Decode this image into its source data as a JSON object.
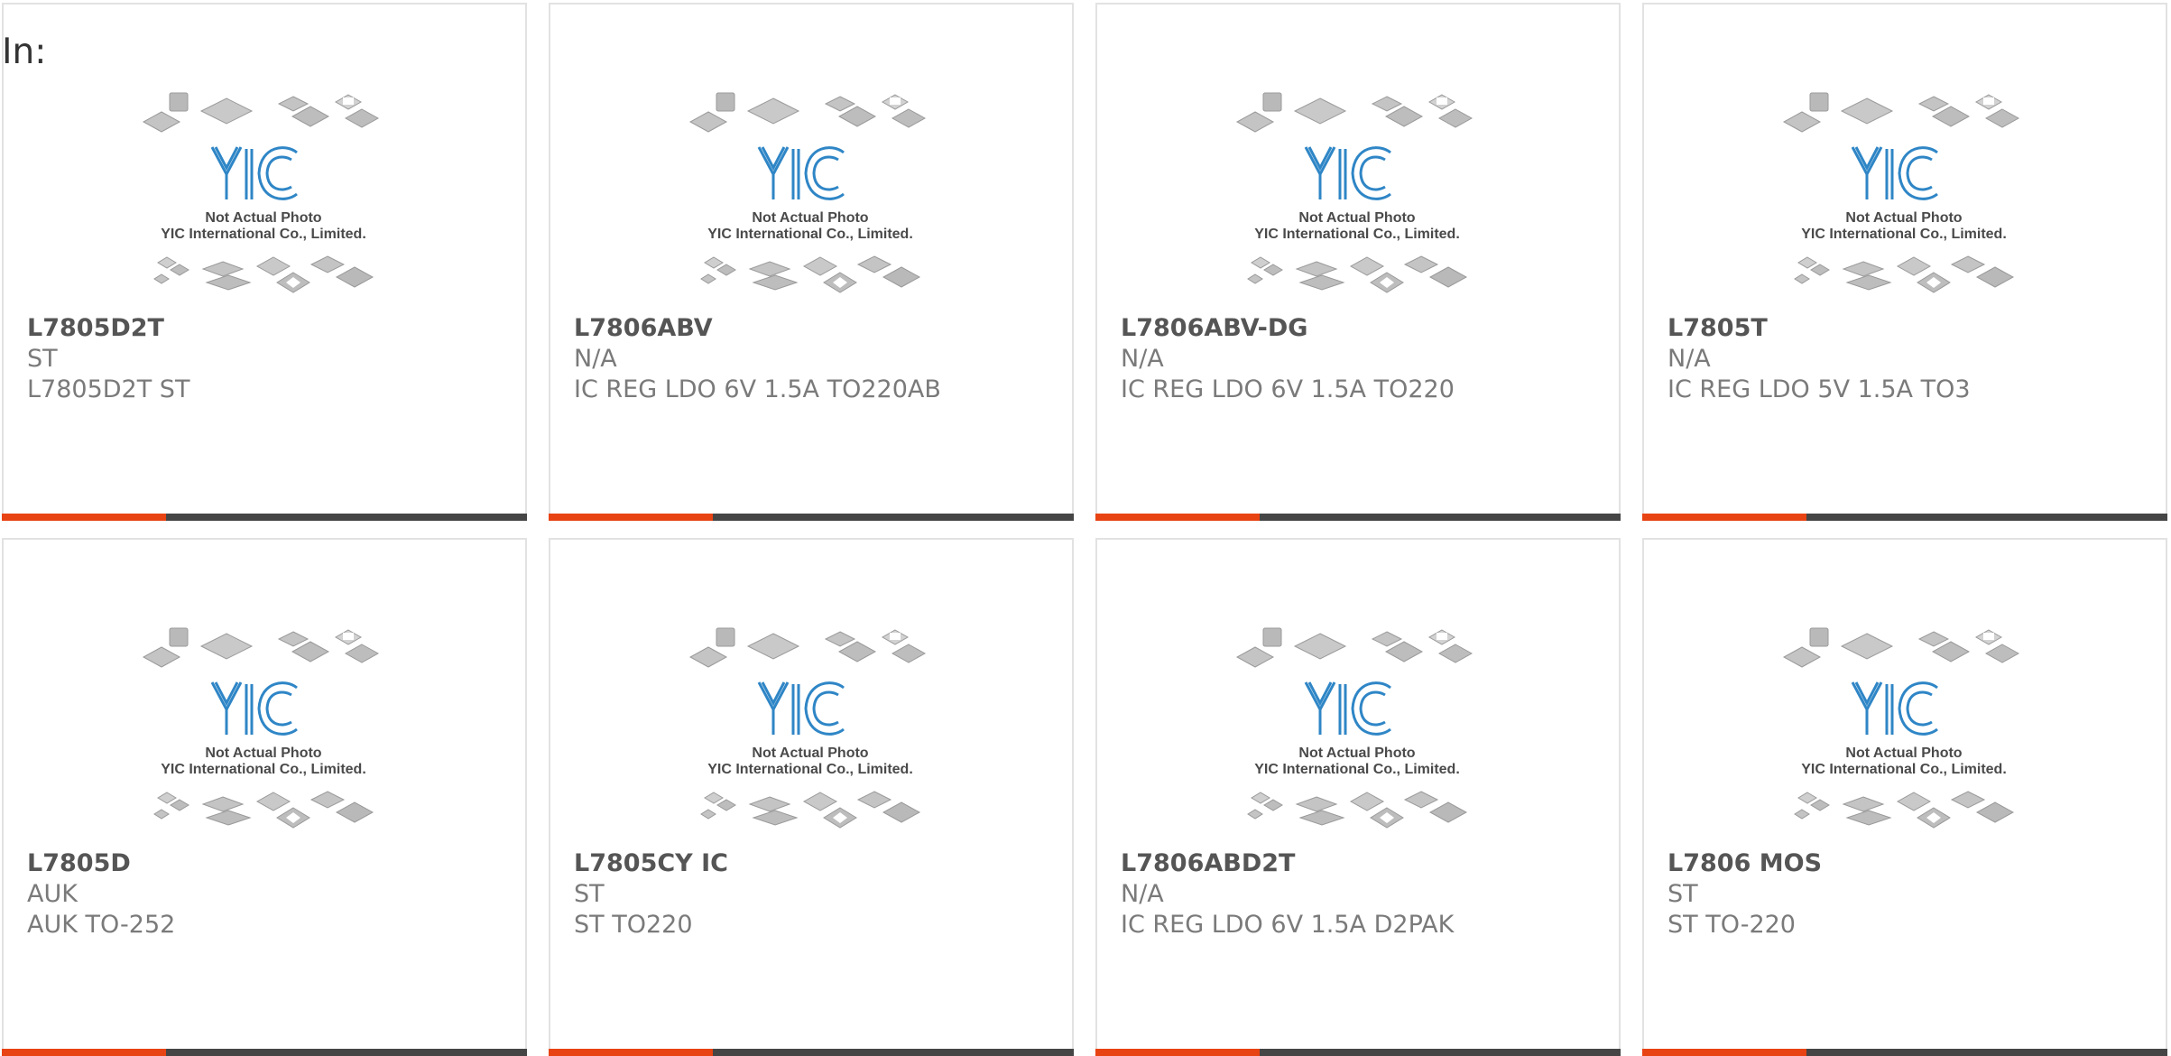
{
  "page": {
    "label": "In:"
  },
  "colors": {
    "accent": "#e84313",
    "bar": "#454545",
    "logo": "#2f86c6",
    "chip": "#b9b9b9"
  },
  "thumbnail": {
    "line1": "Not Actual Photo",
    "line2": "YIC International Co., Limited."
  },
  "products": [
    {
      "part": "L7805D2T",
      "manufacturer": "ST",
      "description": "L7805D2T ST"
    },
    {
      "part": "L7806ABV",
      "manufacturer": "N/A",
      "description": "IC REG LDO 6V 1.5A TO220AB"
    },
    {
      "part": "L7806ABV-DG",
      "manufacturer": "N/A",
      "description": "IC REG LDO 6V 1.5A TO220"
    },
    {
      "part": "L7805T",
      "manufacturer": "N/A",
      "description": "IC REG LDO 5V 1.5A TO3"
    },
    {
      "part": "L7805D",
      "manufacturer": "AUK",
      "description": "AUK TO-252"
    },
    {
      "part": "L7805CY IC",
      "manufacturer": "ST",
      "description": "ST TO220"
    },
    {
      "part": "L7806ABD2T",
      "manufacturer": "N/A",
      "description": "IC REG LDO 6V 1.5A D2PAK"
    },
    {
      "part": "L7806 MOS",
      "manufacturer": "ST",
      "description": "ST TO-220"
    }
  ]
}
